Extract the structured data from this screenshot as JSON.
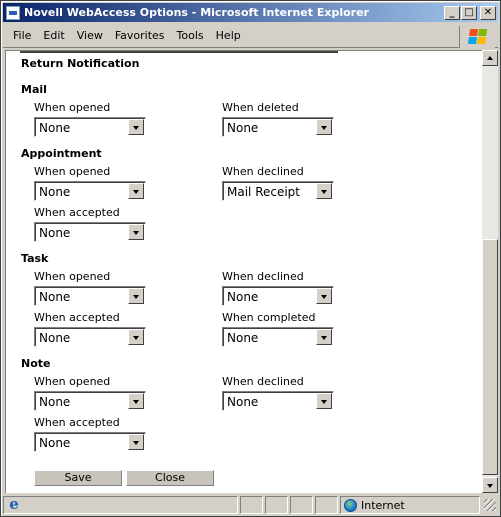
{
  "window": {
    "title": "Novell WebAccess Options - Microsoft Internet Explorer",
    "controls": {
      "minimize": "_",
      "maximize": "□",
      "close": "✕"
    }
  },
  "menu": {
    "items": [
      {
        "label": "File"
      },
      {
        "label": "Edit"
      },
      {
        "label": "View"
      },
      {
        "label": "Favorites"
      },
      {
        "label": "Tools"
      },
      {
        "label": "Help"
      }
    ]
  },
  "page": {
    "heading": "Return Notification",
    "mail": {
      "title": "Mail",
      "opened_label": "When opened",
      "opened_value": "None",
      "deleted_label": "When deleted",
      "deleted_value": "None"
    },
    "appointment": {
      "title": "Appointment",
      "opened_label": "When opened",
      "opened_value": "None",
      "declined_label": "When declined",
      "declined_value": "Mail Receipt",
      "accepted_label": "When accepted",
      "accepted_value": "None"
    },
    "task": {
      "title": "Task",
      "opened_label": "When opened",
      "opened_value": "None",
      "declined_label": "When declined",
      "declined_value": "None",
      "accepted_label": "When accepted",
      "accepted_value": "None",
      "completed_label": "When completed",
      "completed_value": "None"
    },
    "note": {
      "title": "Note",
      "opened_label": "When opened",
      "opened_value": "None",
      "declined_label": "When declined",
      "declined_value": "None",
      "accepted_label": "When accepted",
      "accepted_value": "None"
    },
    "buttons": {
      "save": "Save",
      "close": "Close"
    }
  },
  "statusbar": {
    "zone": "Internet"
  },
  "colors": {
    "titlebar": "#0a246a",
    "chrome": "#d4d0c8"
  }
}
